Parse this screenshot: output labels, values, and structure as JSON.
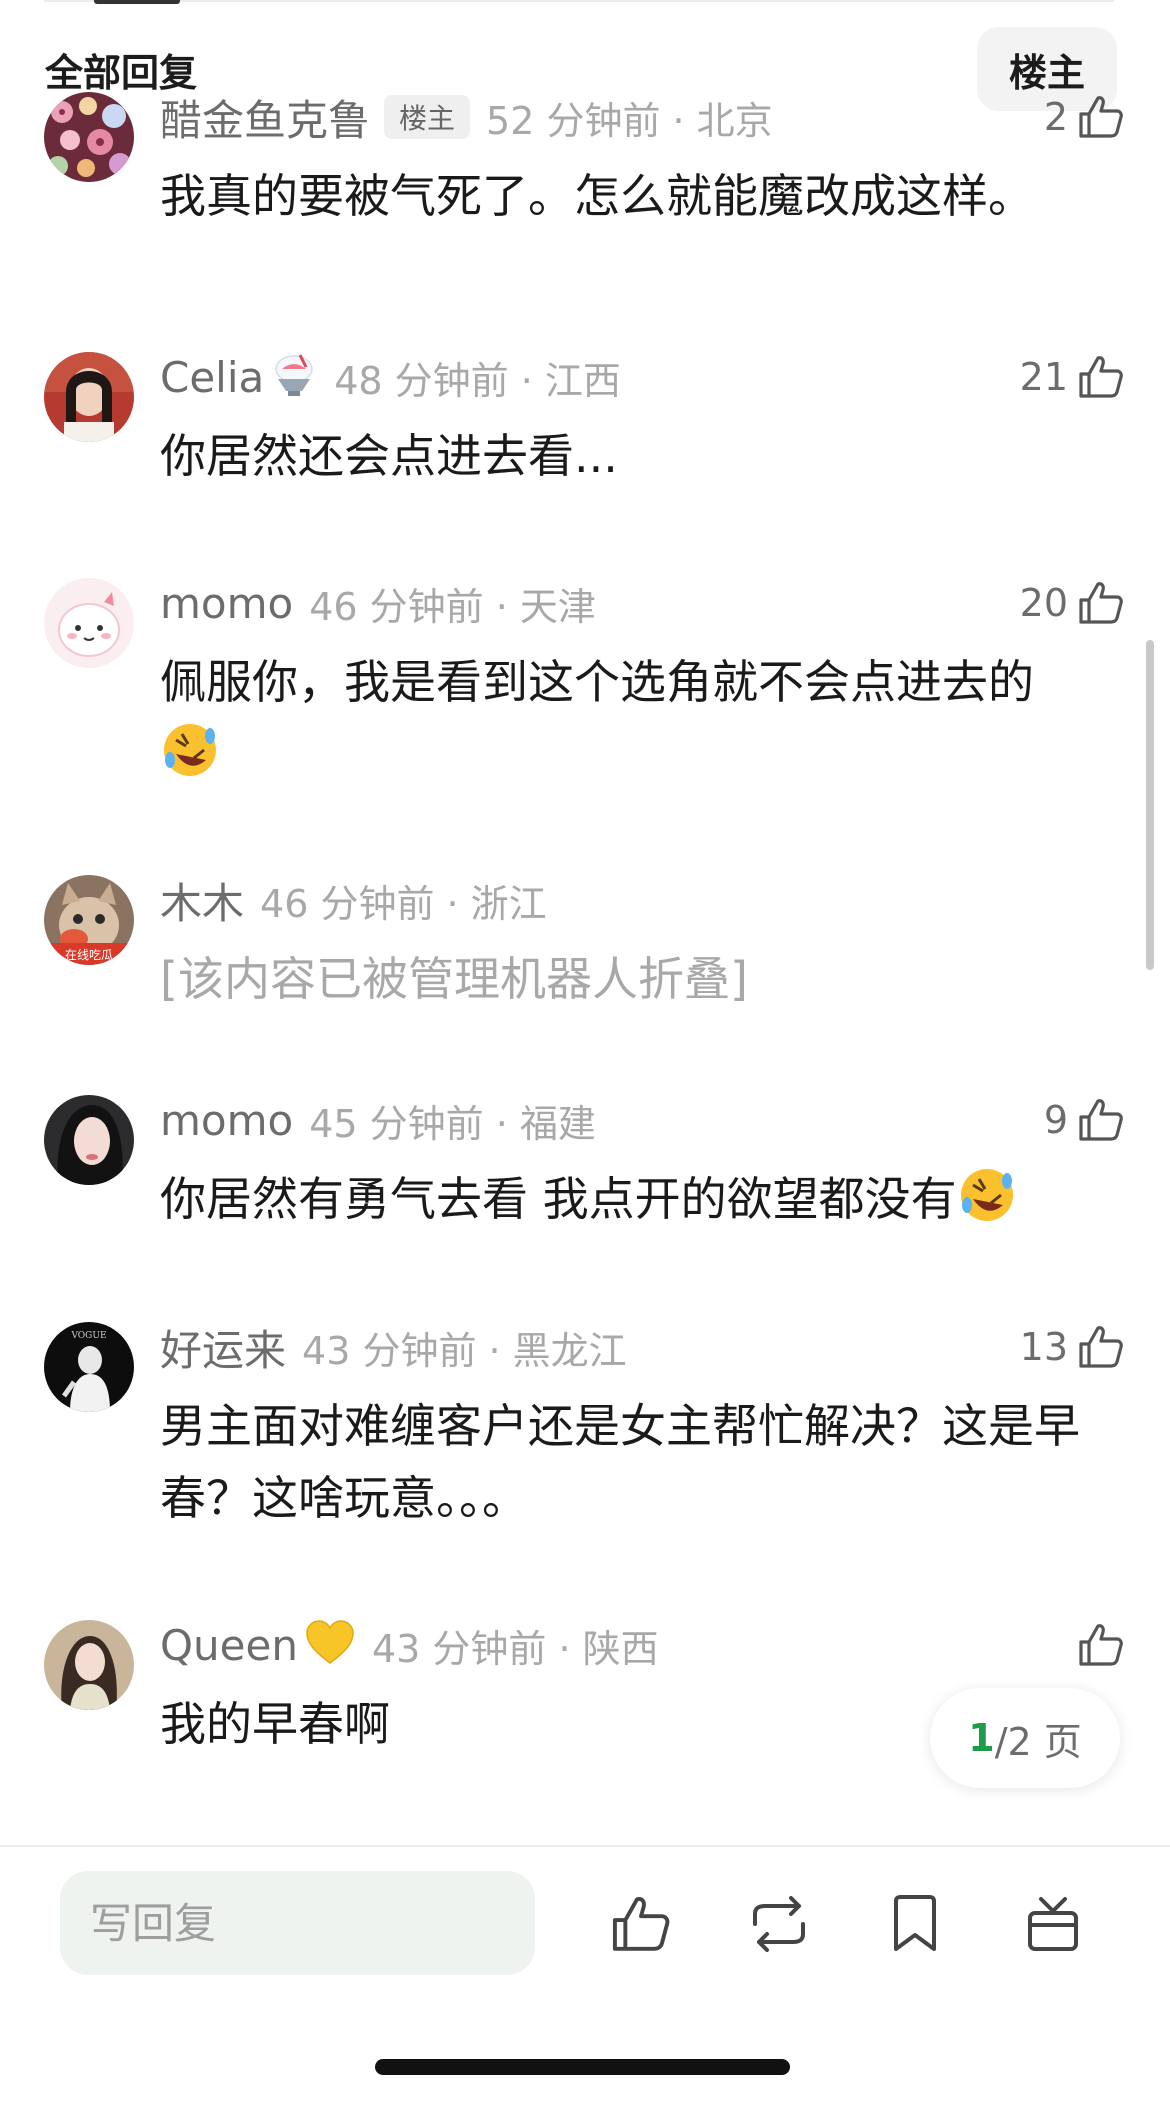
{
  "header": {
    "title": "全部回复",
    "filter_label": "楼主"
  },
  "comments": [
    {
      "username": "醋金鱼克鲁",
      "badge": "楼主",
      "time": "52 分钟前 · 北京",
      "likes": "2",
      "text": "我真的要被气死了。怎么就能魔改成这样。",
      "avatar": "floral-avatar"
    },
    {
      "username": "Celia",
      "time": "48 分钟前 · 江西",
      "likes": "21",
      "text": "你居然还会点进去看...",
      "avatar": "woman-avatar",
      "name_emoji": "shaved-ice-emoji"
    },
    {
      "username": "momo",
      "time": "46 分钟前 · 天津",
      "likes": "20",
      "text": "佩服你，我是看到这个选角就不会点进去的",
      "avatar": "cartoon-avatar",
      "text_emoji": "rolling-laughing-emoji"
    },
    {
      "username": "木木",
      "time": "46 分钟前 · 浙江",
      "likes": "",
      "text": "[该内容已被管理机器人折叠]",
      "avatar": "cat-avatar",
      "avatar_caption": "在线吃瓜",
      "folded": true
    },
    {
      "username": "momo",
      "time": "45 分钟前 · 福建",
      "likes": "9",
      "text": "你居然有勇气去看 我点开的欲望都没有",
      "avatar": "portrait-avatar",
      "text_emoji": "rolling-laughing-emoji"
    },
    {
      "username": "好运来",
      "time": "43 分钟前 · 黑龙江",
      "likes": "13",
      "text": "男主面对难缠客户还是女主帮忙解决？这是早春？这啥玩意。。。",
      "avatar": "bw-avatar",
      "avatar_caption": "VOGUE"
    },
    {
      "username": "Queen",
      "time": "43 分钟前 · 陕西",
      "likes": "",
      "text": "我的早春啊",
      "avatar": "queen-avatar",
      "name_emoji": "yellow-heart-emoji"
    }
  ],
  "pagination": {
    "current": "1",
    "rest": "/2 页"
  },
  "bottom_bar": {
    "reply_placeholder": "写回复",
    "actions": [
      "like-icon",
      "repost-icon",
      "bookmark-icon",
      "gift-icon"
    ]
  },
  "colors": {
    "accent_green": "#1d9c4a",
    "muted_text": "#a8a8a8",
    "input_bg": "#eef3ef"
  }
}
